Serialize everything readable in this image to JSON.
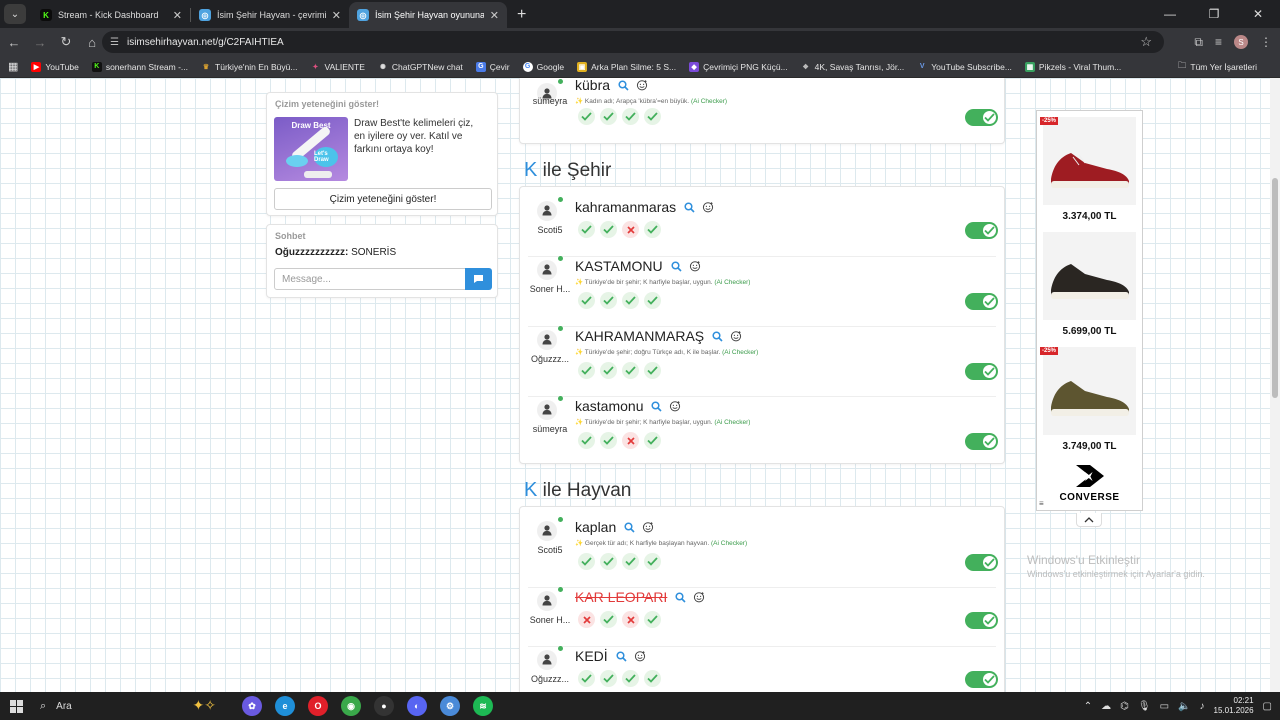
{
  "browser": {
    "tab_menu_icon": "chevron-down",
    "tabs": [
      {
        "title": "Stream - Kick Dashboard",
        "icon_text": "K",
        "icon_color": "#53fc18"
      },
      {
        "title": "İsim Şehir Hayvan - çevrimiçi oy",
        "icon_text": "◎",
        "icon_color": "#4fa3e0"
      },
      {
        "title": "İsim Şehir Hayvan oyununa katı",
        "icon_text": "◎",
        "icon_color": "#4fa3e0"
      }
    ],
    "new_tab": "+",
    "url": "isimsehirhayvan.net/g/C2FAIHTIEA",
    "profile_initial": "S",
    "bookmarks": [
      {
        "label": "YouTube",
        "icon": "▶",
        "color": "#ff0000"
      },
      {
        "label": "sonerhann Stream -...",
        "icon": "K",
        "color": "#222"
      },
      {
        "label": "Türkiye'nin En Büyü...",
        "icon": "♛",
        "color": "#d8a030"
      },
      {
        "label": "VALIENTE",
        "icon": "✦",
        "color": "#b03060"
      },
      {
        "label": "ChatGPTNew chat",
        "icon": "✺",
        "color": "#444"
      },
      {
        "label": "Çevir",
        "icon": "G",
        "color": "#4a7be8"
      },
      {
        "label": "Google",
        "icon": "G",
        "color": "#4285f4"
      },
      {
        "label": "Arka Plan Silme: 5 S...",
        "icon": "▣",
        "color": "#e0b020"
      },
      {
        "label": "Çevrimiçi PNG Küçü...",
        "icon": "◆",
        "color": "#7a4ad8"
      },
      {
        "label": "4K, Savaş Tanrısı, Jör...",
        "icon": "❖",
        "color": "#555"
      },
      {
        "label": "YouTube Subscribe...",
        "icon": "V",
        "color": "#3a6ad8"
      },
      {
        "label": "Pikzels - Viral Thum...",
        "icon": "▦",
        "color": "#38a060"
      }
    ],
    "bookmarks_all": "Tüm Yer İşaretleri"
  },
  "sidebar": {
    "promo": {
      "heading": "Çizim yeteneğini göster!",
      "image_title": "Draw Best",
      "image_blob": "Let's Draw",
      "text": "Draw Best'te kelimeleri çiz, en iyilere oy ver. Katıl ve farkını ortaya koy!",
      "button": "Çizim yeteneğini göster!"
    },
    "chat": {
      "heading": "Sohbet",
      "messages": [
        {
          "user": "Oğuzzzzzzzzzz:",
          "text": " SONERİS"
        }
      ],
      "input_placeholder": "Message..."
    }
  },
  "game": {
    "top_entry": {
      "word": "kübra",
      "user": "sümeyra",
      "hint": "Kadın adı; Arapça 'kübra'=en büyük.",
      "ai": "(Ai Checker)",
      "votes": [
        "ok",
        "ok",
        "ok",
        "ok"
      ],
      "accepted": true
    },
    "sections": [
      {
        "letter": "K",
        "title": " ile Şehir",
        "entries": [
          {
            "word": "kahramanmaras",
            "user": "Scoti5",
            "hint": "",
            "ai": "",
            "votes": [
              "ok",
              "ok",
              "no",
              "ok"
            ],
            "accepted": true,
            "struck": false
          },
          {
            "word": "KASTAMONU",
            "user": "Soner H...",
            "hint": "Türkiye'de bir şehir; K harfiyle başlar, uygun.",
            "ai": "(Ai Checker)",
            "votes": [
              "ok",
              "ok",
              "ok",
              "ok"
            ],
            "accepted": true,
            "struck": false
          },
          {
            "word": "KAHRAMANMARAŞ",
            "user": "Oğuzzz...",
            "hint": "Türkiye'de şehir; doğru Türkçe adı, K ile başlar.",
            "ai": "(Ai Checker)",
            "votes": [
              "ok",
              "ok",
              "ok",
              "ok"
            ],
            "accepted": true,
            "struck": false
          },
          {
            "word": "kastamonu",
            "user": "sümeyra",
            "hint": "Türkiye'de bir şehir; K harfiyle başlar, uygun.",
            "ai": "(Ai Checker)",
            "votes": [
              "ok",
              "ok",
              "no",
              "ok"
            ],
            "accepted": true,
            "struck": false
          }
        ]
      },
      {
        "letter": "K",
        "title": " ile Hayvan",
        "entries": [
          {
            "word": "kaplan",
            "user": "Scoti5",
            "hint": "Gerçek tür adı; K harfiyle başlayan hayvan.",
            "ai": "(Ai Checker)",
            "votes": [
              "ok",
              "ok",
              "ok",
              "ok"
            ],
            "accepted": true,
            "struck": false
          },
          {
            "word": "KAR LEOPARI",
            "user": "Soner H...",
            "hint": "",
            "ai": "",
            "votes": [
              "no",
              "ok",
              "no",
              "ok"
            ],
            "accepted": true,
            "struck": true
          },
          {
            "word": "KEDİ",
            "user": "Oğuzzz...",
            "hint": "",
            "ai": "",
            "votes": [
              "ok",
              "ok",
              "ok",
              "ok"
            ],
            "accepted": true,
            "struck": false
          }
        ]
      }
    ]
  },
  "ad": {
    "items": [
      {
        "price": "3.374,00 TL",
        "discount": "-25%",
        "shoe_color": "#9e1c22"
      },
      {
        "price": "5.699,00 TL",
        "discount": "",
        "shoe_color": "#2a2622"
      },
      {
        "price": "3.749,00 TL",
        "discount": "-25%",
        "shoe_color": "#5d5530"
      }
    ],
    "brand": "CONVERSE"
  },
  "watermark": {
    "line1": "Windows'u Etkinleştir",
    "line2": "Windows'u etkinleştirmek için Ayarlar'a gidin."
  },
  "taskbar": {
    "search": "Ara",
    "apps": [
      {
        "name": "copilot",
        "text": "✿",
        "color": "#6a5ae0"
      },
      {
        "name": "edge",
        "text": "e",
        "color": "#1f8fd8"
      },
      {
        "name": "opera",
        "text": "O",
        "color": "#e0202a"
      },
      {
        "name": "chrome",
        "text": "◉",
        "color": "#3aa84a"
      },
      {
        "name": "obs",
        "text": "●",
        "color": "#333"
      },
      {
        "name": "discord",
        "text": "◐",
        "color": "#5865f2"
      },
      {
        "name": "settings",
        "text": "⚙",
        "color": "#4a8ad8"
      },
      {
        "name": "spotify",
        "text": "≋",
        "color": "#1db954"
      }
    ],
    "time": "02:21",
    "date": "15.01.2026"
  }
}
